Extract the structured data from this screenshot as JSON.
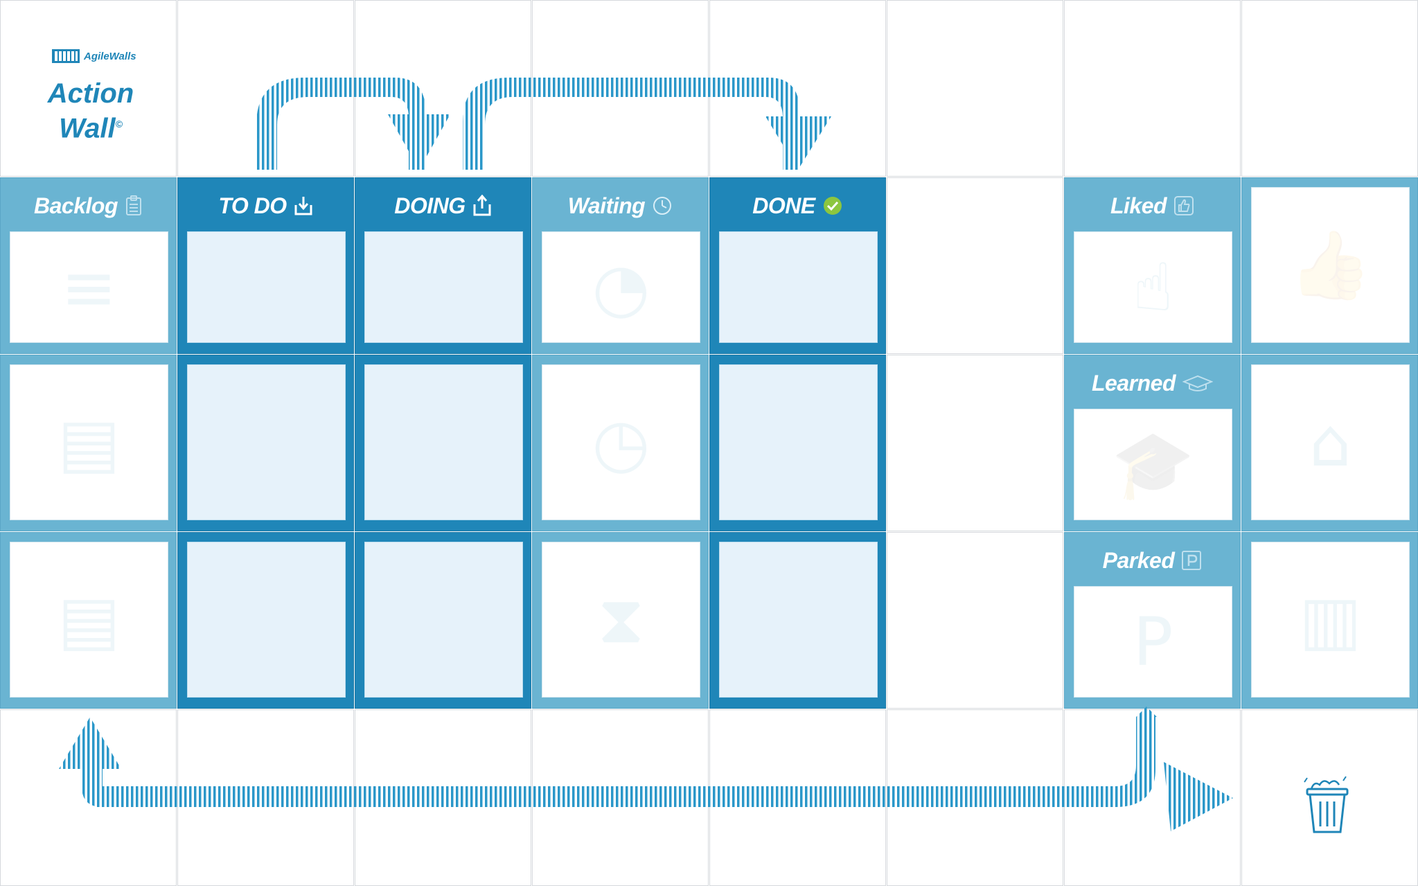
{
  "brand": {
    "logo_text": "AgileWalls",
    "title_line1": "Action",
    "title_line2": "Wall",
    "title_mark": "©"
  },
  "columns": {
    "backlog": {
      "label": "Backlog",
      "icon": "clipboard-icon"
    },
    "todo": {
      "label": "TO DO",
      "icon": "download-icon"
    },
    "doing": {
      "label": "DOING",
      "icon": "upload-icon"
    },
    "waiting": {
      "label": "Waiting",
      "icon": "clock-icon"
    },
    "done": {
      "label": "DONE",
      "icon": "check-circle-icon"
    }
  },
  "side": {
    "liked": {
      "label": "Liked",
      "icon": "thumbs-up-icon"
    },
    "learned": {
      "label": "Learned",
      "icon": "graduation-cap-icon"
    },
    "parked": {
      "label": "Parked",
      "icon": "parking-icon"
    }
  },
  "trash": {
    "icon": "trash-can-icon"
  },
  "colors": {
    "light_blue": "#6ab4d2",
    "dark_blue": "#1f86b8",
    "card_tint": "#e6f2fa",
    "done_green": "#8cc63f"
  }
}
